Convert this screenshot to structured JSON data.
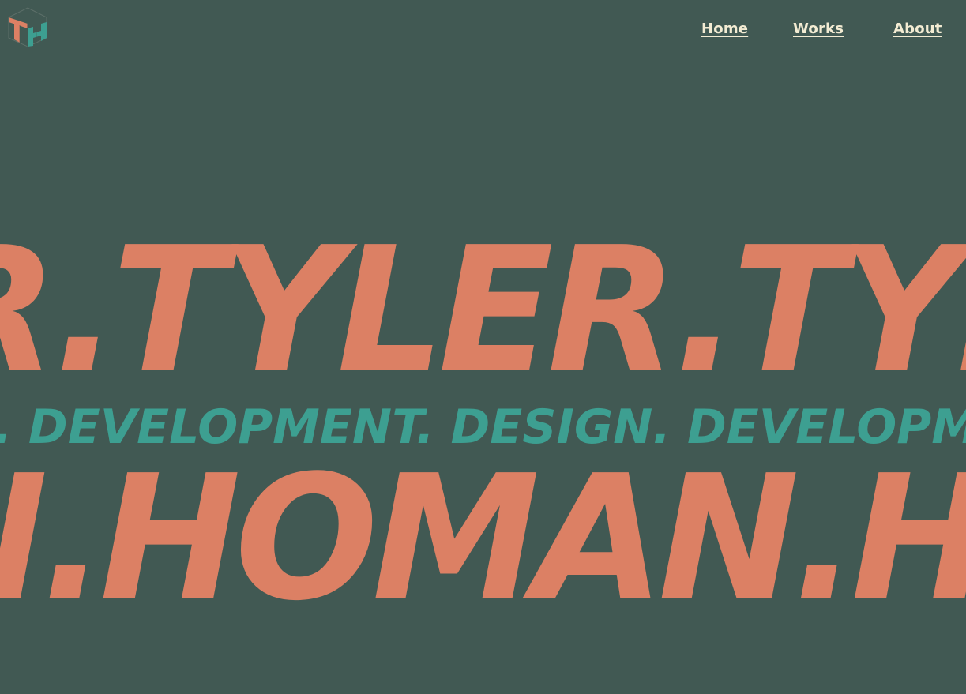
{
  "logo": {
    "icon": "th-monogram-logo",
    "colors": {
      "t_letter": "#dc8064",
      "h_letter": "#3d9f91",
      "outline": "#5d7069"
    }
  },
  "nav": {
    "items": [
      {
        "label": "Home"
      },
      {
        "label": "Works"
      },
      {
        "label": "About"
      }
    ],
    "text_color": "#f3ecd3"
  },
  "hero": {
    "line_1": "R.TYLER.TYLER.T",
    "line_2": "N. DEVELOPMENT. DESIGN. DEVELOPMENT.",
    "line_3": "N.HOMAN.HOMAN.H"
  },
  "theme": {
    "background": "#415953",
    "accent_primary": "#dc8064",
    "accent_secondary": "#3d9f91"
  }
}
